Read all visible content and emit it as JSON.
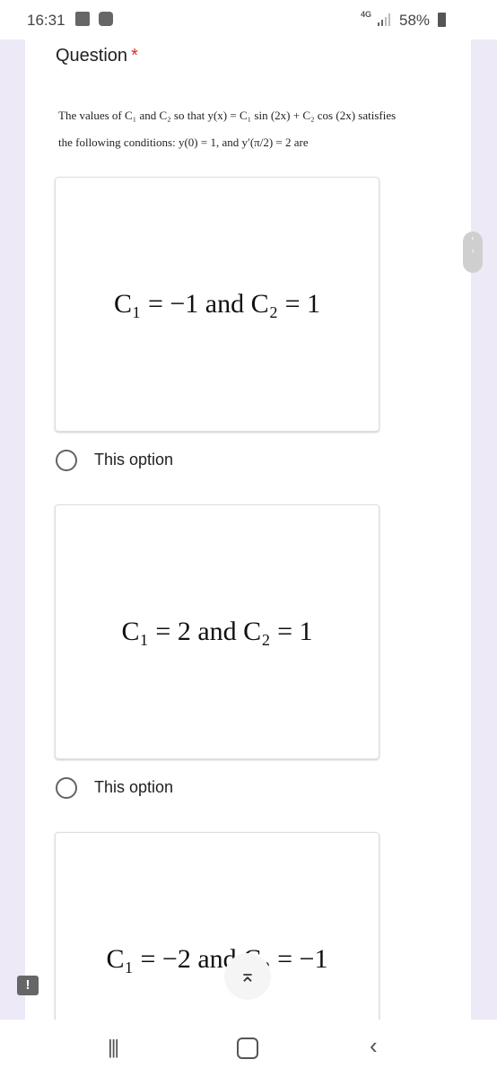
{
  "statusbar": {
    "time": "16:31",
    "network": "4G",
    "battery_percent": "58%",
    "icons": [
      "gallery-icon",
      "app-notification-icon",
      "signal-icon",
      "battery-icon"
    ]
  },
  "question": {
    "title": "Question",
    "required_marker": "*",
    "text_line1": "The values of C₁ and C₂ so that y(x) = C₁ sin (2x) + C₂ cos (2x) satisfies",
    "text_line2": "the following conditions: y(0) = 1, and y′(π/2) = 2 are"
  },
  "options": [
    {
      "equation": "C₁ = −1 and C₂ = 1",
      "label": "This option",
      "selected": false
    },
    {
      "equation": "C₁ = 2 and C₂ = 1",
      "label": "This option",
      "selected": false
    },
    {
      "equation": "C₁ = −2 and C₂ = −1",
      "label": "",
      "selected": false
    }
  ],
  "scroll_top_icon": "⌅",
  "feedback_icon": "!",
  "navbar": {
    "recents": "|||",
    "back": "‹"
  }
}
